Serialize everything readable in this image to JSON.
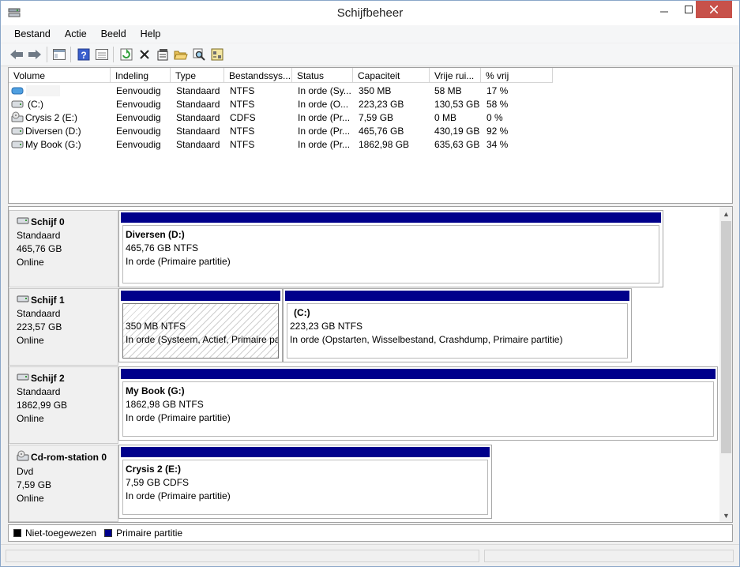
{
  "window": {
    "title": "Schijfbeheer"
  },
  "menu": [
    "Bestand",
    "Actie",
    "Beeld",
    "Help"
  ],
  "toolbar": {
    "icons": [
      "back-arrow-icon",
      "forward-arrow-icon",
      "console-icon",
      "help-icon",
      "view-list-icon",
      "refresh-icon",
      "delete-icon",
      "properties-icon",
      "open-folder-icon",
      "search-icon",
      "settings-icon"
    ]
  },
  "volume_list": {
    "columns": [
      "Volume",
      "Indeling",
      "Type",
      "Bestandssys...",
      "Status",
      "Capaciteit",
      "Vrije rui...",
      "% vrij"
    ],
    "rows": [
      {
        "volume": "",
        "indeling": "Eenvoudig",
        "type": "Standaard",
        "fs": "NTFS",
        "status": "In orde (Sy...",
        "cap": "350 MB",
        "free": "58 MB",
        "pct": "17 %",
        "icon": "volume-blue-icon"
      },
      {
        "volume": "(C:)",
        "indeling": "Eenvoudig",
        "type": "Standaard",
        "fs": "NTFS",
        "status": "In orde (O...",
        "cap": "223,23 GB",
        "free": "130,53 GB",
        "pct": "58 %",
        "icon": "drive-icon"
      },
      {
        "volume": "Crysis 2 (E:)",
        "indeling": "Eenvoudig",
        "type": "Standaard",
        "fs": "CDFS",
        "status": "In orde (Pr...",
        "cap": "7,59 GB",
        "free": "0 MB",
        "pct": "0 %",
        "icon": "cdrom-icon"
      },
      {
        "volume": "Diversen (D:)",
        "indeling": "Eenvoudig",
        "type": "Standaard",
        "fs": "NTFS",
        "status": "In orde (Pr...",
        "cap": "465,76 GB",
        "free": "430,19 GB",
        "pct": "92 %",
        "icon": "drive-icon"
      },
      {
        "volume": "My Book (G:)",
        "indeling": "Eenvoudig",
        "type": "Standaard",
        "fs": "NTFS",
        "status": "In orde (Pr...",
        "cap": "1862,98 GB",
        "free": "635,63 GB",
        "pct": "34 %",
        "icon": "drive-icon"
      }
    ]
  },
  "disks": [
    {
      "name": "Schijf 0",
      "type": "Standaard",
      "size": "465,76 GB",
      "state": "Online",
      "partitions": [
        {
          "name": "Diversen  (D:)",
          "size": "465,76 GB NTFS",
          "status": "In orde (Primaire partitie)"
        }
      ]
    },
    {
      "name": "Schijf 1",
      "type": "Standaard",
      "size": "223,57 GB",
      "state": "Online",
      "partitions": [
        {
          "name": "",
          "size": "350 MB NTFS",
          "status": "In orde (Systeem, Actief, Primaire pa"
        },
        {
          "name": "(C:)",
          "size": "223,23 GB NTFS",
          "status": "In orde (Opstarten, Wisselbestand, Crashdump, Primaire partitie)"
        }
      ]
    },
    {
      "name": "Schijf 2",
      "type": "Standaard",
      "size": "1862,99 GB",
      "state": "Online",
      "partitions": [
        {
          "name": "My Book  (G:)",
          "size": "1862,98 GB NTFS",
          "status": "In orde (Primaire partitie)"
        }
      ]
    },
    {
      "name": "Cd-rom-station 0",
      "type": "Dvd",
      "size": "7,59 GB",
      "state": "Online",
      "partitions": [
        {
          "name": "Crysis 2  (E:)",
          "size": "7,59 GB CDFS",
          "status": "In orde (Primaire partitie)"
        }
      ]
    }
  ],
  "legend": [
    {
      "label": "Niet-toegewezen",
      "color": "#000000"
    },
    {
      "label": "Primaire partitie",
      "color": "#00008b"
    }
  ]
}
